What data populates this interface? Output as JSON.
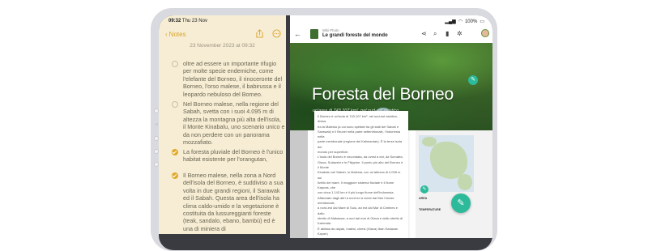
{
  "status_left": {
    "time": "09:32",
    "date": "Thu 23 Nov"
  },
  "status_right": {
    "battery": "100%"
  },
  "notes": {
    "back_label": "Notes",
    "date": "23 November 2023 at 09:32",
    "items": [
      {
        "checked": false,
        "text": "oltre ad essere un importante rifugio per molte specie endemiche, come l'elefante del Borneo, il rinoceronte del Borneo, l'orso malese, il babirussa e il leopardo nebuloso del Borneo."
      },
      {
        "checked": false,
        "text": "Nel Borneo malese, nella regione del Sabah, svetta con i suoi 4.095 m di altezza la montagna più alta dell'isola, il Monte Kinabalu, uno scenario unico e da non perdere con un panorama mozzafiato."
      },
      {
        "checked": true,
        "text": "La foresta pluviale del Borneo è l'unico habitat esistente per l'orangutan,"
      },
      {
        "checked": true,
        "text": "Il Borneo malese, nella zona a Nord dell'isola del Borneo, è suddiviso a sua volta in due grandi regioni, il Sarawak ed il Sabah. Questa area dell'isola ha clima caldo-umido e la vegetazione è costituita da lussureggianti foreste (teak, sandalo, ebano, bambù) ed è una di miniera di"
      }
    ]
  },
  "article": {
    "app_name": "Wiki Photo",
    "title": "Le grandi foreste del mondo",
    "hero_title": "Foresta del Borneo",
    "hero_subtitle": "un'area di 743.107 km², nel sud-est asiatico",
    "body_lines": [
      "Il Borneo è un'isola di 743.107 km², nel sud-est asiatico, divisa",
      "tra la Malesia (a cui sono spettati tra gli stati del Sabah e",
      "Sarawak) e il Brunei nella parte settentrionale, l'Indonesia nella",
      "parte meridionale (regione del Kalimantan). È la terza isola del",
      "mondo per superficie.",
      "L'isola del Borneo è circondata, da ovest a est, da Sumatra,",
      "Giava, Sulawesi e le Filippine. Il punto più alto del Borneo è il Monte",
      "Kinabalu nel Sabah, in Malesia, con un'altezza di 4.095 m sul",
      "livello del mare. Il maggiore sistema fluviale è il fiume Kapuas, che",
      "con circa 1.143 km è il più lungo fiume dell'Indonesia.",
      "Affacciato dagli altri a nord ed a ovest dal Mar Cinese meridionale,",
      "a nord-est dal Mare di Sulu, ad est dal Mar di Celebes e dallo",
      "stretto di Makassar, a sud dal mar di Giava e dallo stretto di",
      "Karimata.",
      "È abitata da dayak, malesi, cinesi (Giava) Iban Kadazan Kayan)"
    ],
    "info_label_1": "AREA",
    "info_label_2": "TEMPERATURE"
  },
  "icons": [
    "chevron-left-icon",
    "share-icon",
    "more-icon",
    "back-arrow-icon",
    "share-icon",
    "search-icon",
    "bookmark-icon",
    "settings-icon",
    "pencil-icon"
  ]
}
